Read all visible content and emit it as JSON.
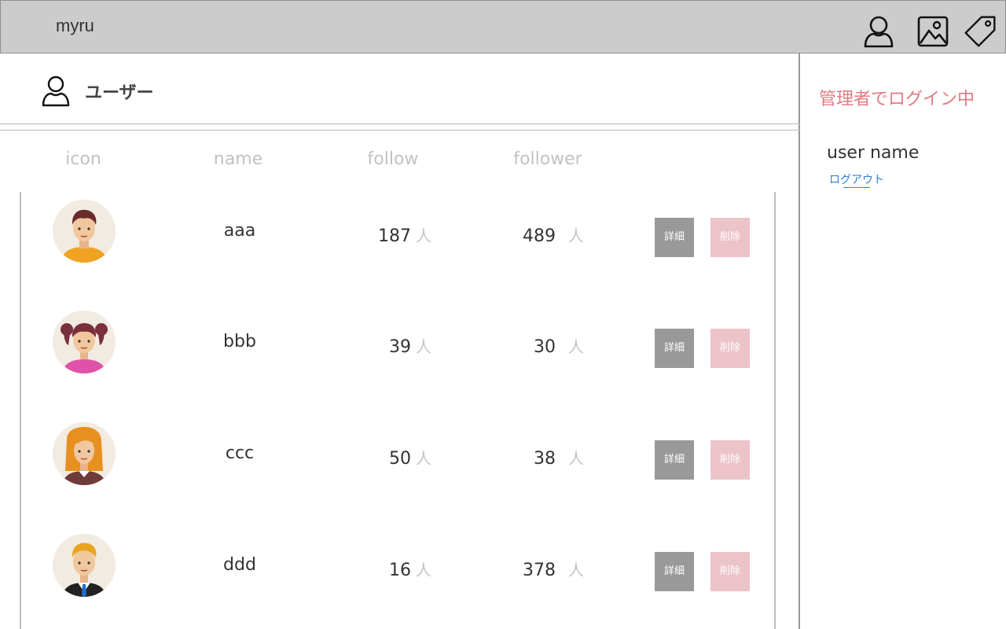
{
  "app": {
    "title": "myru"
  },
  "header_icons": [
    "user-icon",
    "image-icon",
    "tag-icon"
  ],
  "page": {
    "title": "ユーザー",
    "title_icon": "user-icon"
  },
  "columns": {
    "icon": "icon",
    "name": "name",
    "follow": "follow",
    "follower": "follower"
  },
  "unit": "人",
  "buttons": {
    "detail": "詳細",
    "delete": "削除"
  },
  "users": [
    {
      "name": "aaa",
      "follow": "187",
      "follower": "489",
      "avatar": "man-orange-shirt"
    },
    {
      "name": "bbb",
      "follow": "39",
      "follower": "30",
      "avatar": "girl-pigtails"
    },
    {
      "name": "ccc",
      "follow": "50",
      "follower": "38",
      "avatar": "woman-blonde"
    },
    {
      "name": "ddd",
      "follow": "16",
      "follower": "378",
      "avatar": "man-suit"
    }
  ],
  "sidebar": {
    "status": "管理者でログイン中",
    "user_name": "user name",
    "logout": "ログアウト"
  },
  "colors": {
    "topbar": "#cccccc",
    "detail_button": "#999999",
    "delete_button": "#ecc3c9",
    "status_text": "#e07a80",
    "link": "#2f7fd3"
  }
}
